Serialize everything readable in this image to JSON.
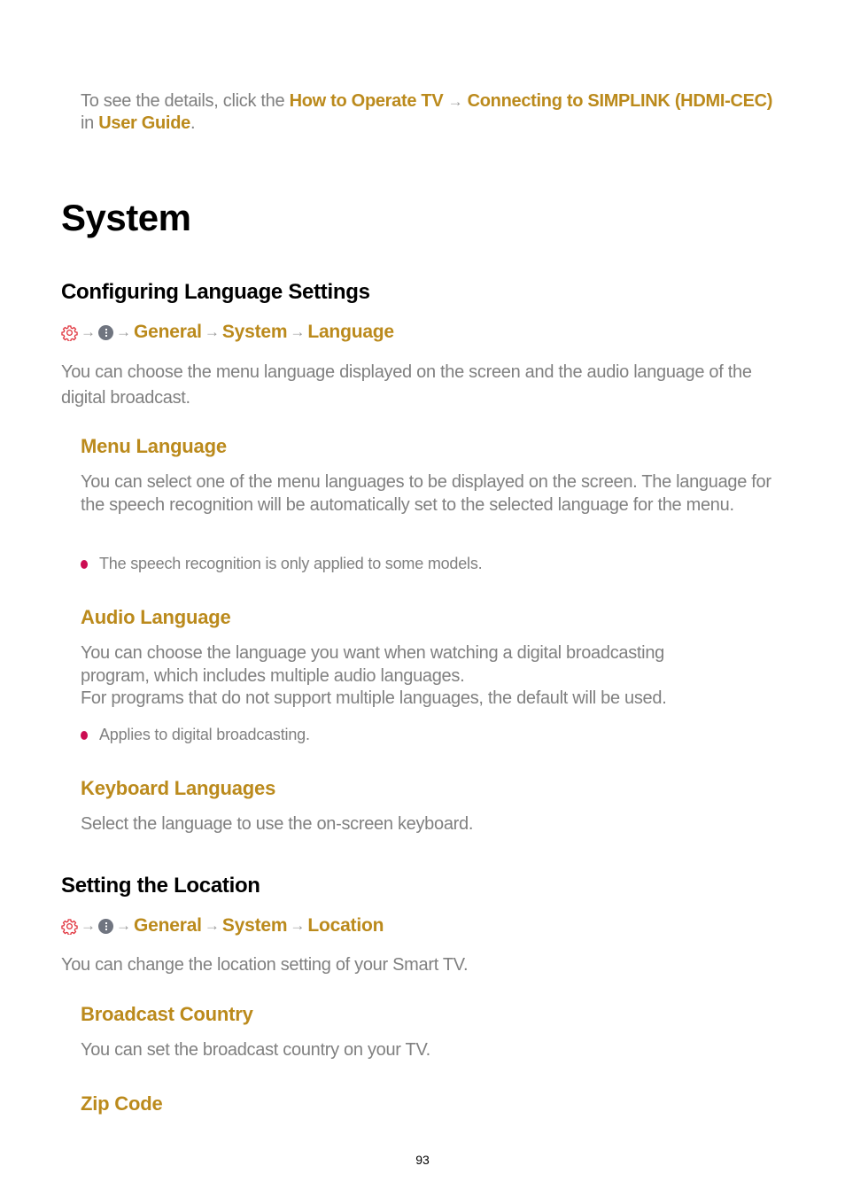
{
  "note": {
    "prefix": "To see the details, click the ",
    "link1": "How to Operate TV",
    "arrow": "→",
    "link2": "Connecting to SIMPLINK (HDMI-CEC)",
    "middle": " in ",
    "link3": "User Guide",
    "suffix": "."
  },
  "title": "System",
  "sections": {
    "language": {
      "heading": "Configuring Language Settings",
      "path": [
        "General",
        "System",
        "Language"
      ],
      "description": "You can choose the menu language displayed on the screen and the audio language of the digital broadcast.",
      "menu_language": {
        "heading": "Menu Language",
        "body": "You can select one of the menu languages to be displayed on the screen. The language for the speech recognition will be automatically set to the selected language for the menu.",
        "bullet": "The speech recognition is only applied to some models."
      },
      "audio_language": {
        "heading": "Audio Language",
        "body1": "You can choose the language you want when watching a digital broadcasting program, which includes multiple audio languages.",
        "body2": "For programs that do not support multiple languages, the default will be used.",
        "bullet": "Applies to digital broadcasting."
      },
      "keyboard_languages": {
        "heading": "Keyboard Languages",
        "body": "Select the language to use the on-screen keyboard."
      }
    },
    "location": {
      "heading": "Setting the Location",
      "path": [
        "General",
        "System",
        "Location"
      ],
      "description": "You can change the location setting of your Smart TV.",
      "broadcast_country": {
        "heading": "Broadcast Country",
        "body": "You can set the broadcast country on your TV."
      },
      "zip_code": {
        "heading": "Zip Code"
      }
    }
  },
  "icons": {
    "arrow": "→"
  },
  "colors": {
    "accent": "#bb8a1c",
    "bullet": "#cc0d52",
    "gear": "#e0303a",
    "body_text": "#808080"
  },
  "page_number": "93"
}
